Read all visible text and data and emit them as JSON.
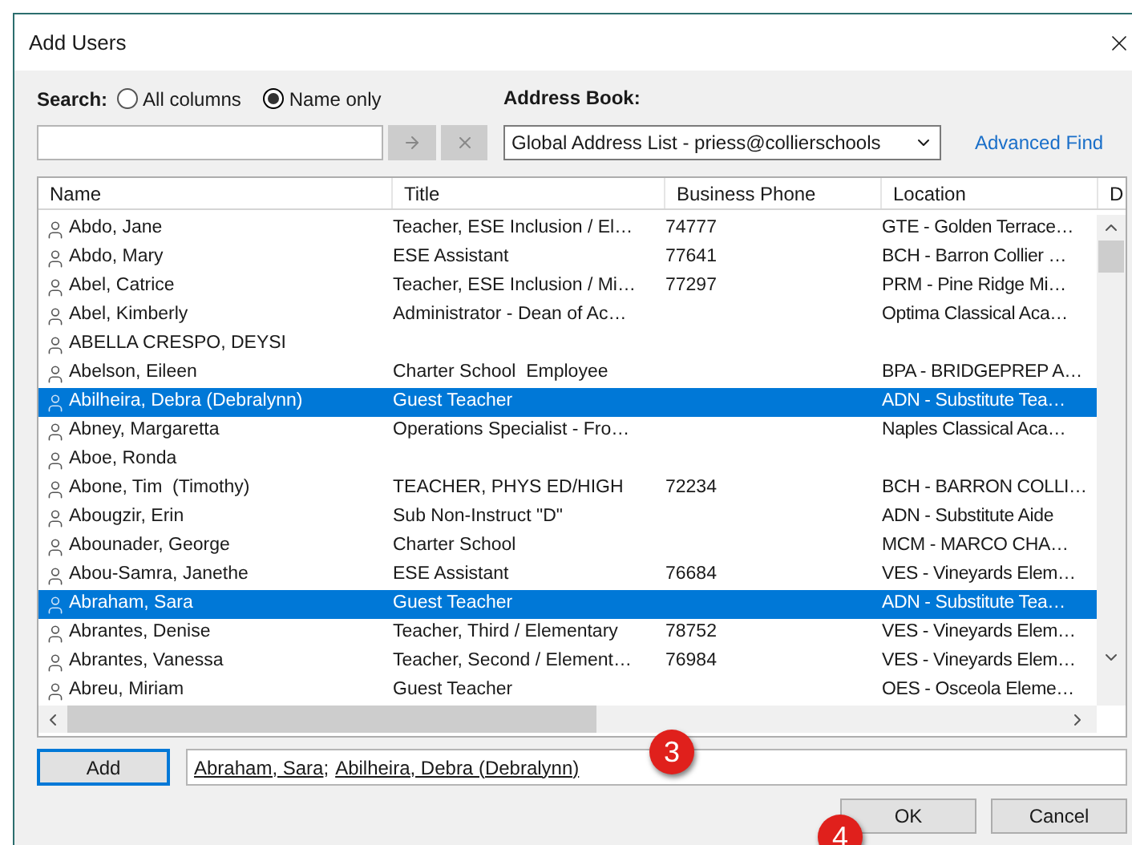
{
  "window": {
    "title": "Add Users"
  },
  "search": {
    "label": "Search:",
    "options": [
      {
        "label": "All columns",
        "selected": false
      },
      {
        "label": "Name only",
        "selected": true
      }
    ],
    "go_disabled": true,
    "clear_disabled": true
  },
  "address_book": {
    "label": "Address Book:",
    "value": "Global Address List - priess@collierschools",
    "link": "Advanced Find"
  },
  "table": {
    "columns": [
      "Name",
      "Title",
      "Business Phone",
      "Location",
      "D"
    ],
    "rows": [
      {
        "name": "Abdo, Jane",
        "title": "Teacher, ESE Inclusion / El…",
        "phone": "74777",
        "location": "GTE - Golden Terrace…",
        "selected": false
      },
      {
        "name": "Abdo, Mary",
        "title": "ESE Assistant",
        "phone": "77641",
        "location": "BCH - Barron Collier …",
        "selected": false
      },
      {
        "name": "Abel, Catrice",
        "title": "Teacher, ESE Inclusion / Mi…",
        "phone": "77297",
        "location": "PRM - Pine Ridge Mi…",
        "selected": false
      },
      {
        "name": "Abel, Kimberly",
        "title": "Administrator - Dean of Ac…",
        "location": "Optima Classical Aca…",
        "selected": false
      },
      {
        "name": "ABELLA CRESPO, DEYSI",
        "selected": false
      },
      {
        "name": "Abelson, Eileen",
        "title": "Charter School  Employee",
        "location": "BPA - BRIDGEPREP A…",
        "selected": false
      },
      {
        "name": "Abilheira, Debra (Debralynn)",
        "title": "Guest Teacher",
        "location": "ADN - Substitute Tea…",
        "selected": true
      },
      {
        "name": "Abney, Margaretta",
        "title": "Operations Specialist - Fro…",
        "location": "Naples Classical Aca…",
        "selected": false
      },
      {
        "name": "Aboe, Ronda",
        "selected": false
      },
      {
        "name": "Abone, Tim  (Timothy)",
        "title": "TEACHER, PHYS ED/HIGH",
        "phone": "72234",
        "location": "BCH - BARRON COLLI…",
        "selected": false
      },
      {
        "name": "Abougzir, Erin",
        "title": "Sub Non-Instruct \"D\"",
        "location": "ADN - Substitute Aide",
        "selected": false
      },
      {
        "name": "Abounader, George",
        "title": "Charter School",
        "location": "MCM - MARCO CHA…",
        "selected": false
      },
      {
        "name": "Abou-Samra, Janethe",
        "title": "ESE Assistant",
        "phone": "76684",
        "location": "VES - Vineyards Elem…",
        "selected": false
      },
      {
        "name": "Abraham, Sara",
        "title": "Guest Teacher",
        "location": "ADN - Substitute Tea…",
        "selected": true
      },
      {
        "name": "Abrantes, Denise",
        "title": "Teacher, Third / Elementary",
        "phone": "78752",
        "location": "VES - Vineyards Elem…",
        "selected": false
      },
      {
        "name": "Abrantes, Vanessa",
        "title": "Teacher, Second / Element…",
        "phone": "76984",
        "location": "VES - Vineyards Elem…",
        "selected": false
      },
      {
        "name": "Abreu, Miriam",
        "title": "Guest Teacher",
        "location": "OES - Osceola Eleme…",
        "selected": false
      }
    ]
  },
  "add_button": "Add",
  "recipients": {
    "items": [
      "Abraham, Sara",
      "Abilheira, Debra (Debralynn)"
    ],
    "separator": ";"
  },
  "buttons": [
    "OK",
    "Cancel"
  ],
  "callouts": [
    "3",
    "4"
  ]
}
